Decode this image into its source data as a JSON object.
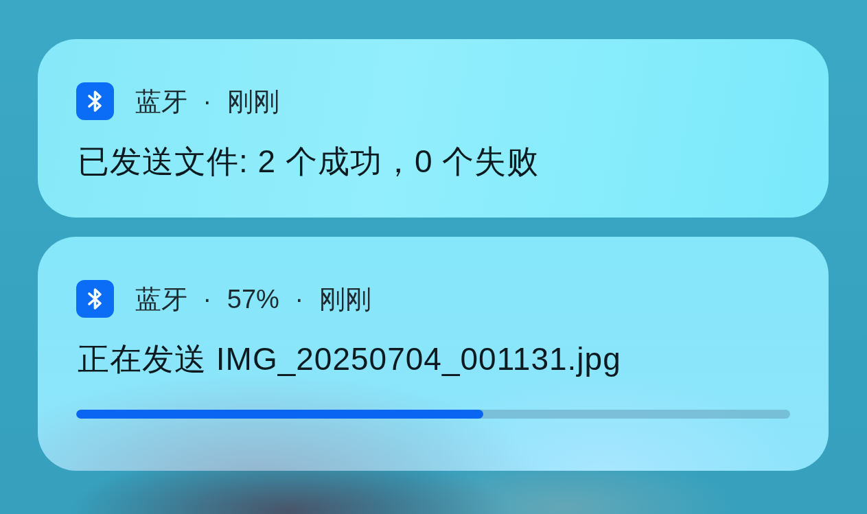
{
  "notifications": [
    {
      "kind": "message",
      "header": "蓝牙 · 刚刚",
      "body": "已发送文件: 2 个成功，0 个失败"
    },
    {
      "kind": "progress",
      "header": "蓝牙 · 57% · 刚刚",
      "body": "正在发送 IMG_20250704_001131.jpg",
      "progress": {
        "level": 0.57
      }
    }
  ]
}
